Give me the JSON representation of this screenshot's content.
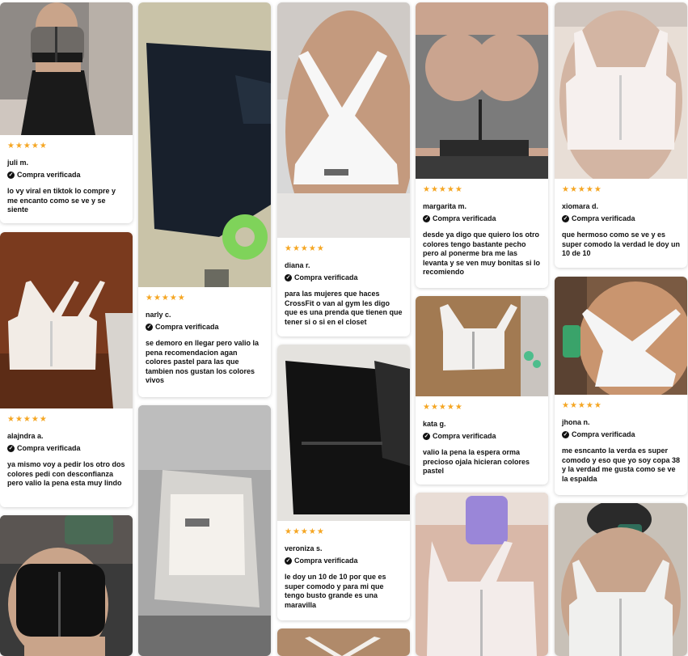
{
  "stars": "★★★★★",
  "verified_label": "Compra verificada",
  "verified_icon": "check-circle-icon",
  "columns": [
    {
      "reviews": [
        {
          "name": "juli m.",
          "text": "lo vy viral en tiktok lo compre y me encanto como se ve y se siente",
          "photo_colors": [
            "#6e6a66",
            "#1a1a1a",
            "#cfc6bf"
          ]
        },
        {
          "name": "alajndra a.",
          "text": "ya mismo voy a pedir los otro dos colores pedi con desconfianza pero valio la pena esta muy lindo",
          "photo_colors": [
            "#7a3a1e",
            "#f2ece6",
            "#5c2c16"
          ]
        },
        {
          "name": "",
          "text": "",
          "photo_colors": [
            "#3a3a3a",
            "#111111",
            "#c9a48a"
          ]
        }
      ]
    },
    {
      "reviews": [
        {
          "name": "narly c.",
          "text": "se demoro en llegar pero valio la pena recomendacion agan colores pastel para las que tambien nos gustan los colores vivos",
          "photo_colors": [
            "#c9c3a8",
            "#18202c",
            "#7fd35a"
          ]
        },
        {
          "name": "",
          "text": "",
          "photo_colors": [
            "#a8a8a8",
            "#f4f1ec",
            "#6e6e6e"
          ]
        }
      ]
    },
    {
      "reviews": [
        {
          "name": "diana r.",
          "text": "para las mujeres que haces CrossFit o van al gym les digo que es una prenda que tienen que tener si o si en el closet",
          "photo_colors": [
            "#d8d8d8",
            "#f7f7f7",
            "#c49a7e"
          ]
        },
        {
          "name": "veroniza s.",
          "text": "le doy un 10 de 10 por que es super comodo y para mi que tengo busto grande es una maravilla",
          "photo_colors": [
            "#e4e2de",
            "#121212",
            "#2b2b2b"
          ]
        },
        {
          "name": "",
          "text": "",
          "photo_colors": [
            "#b08a6a",
            "#f3f0ec",
            "#8a6a52"
          ]
        }
      ]
    },
    {
      "reviews": [
        {
          "name": "margarita m.",
          "text": "desde ya digo que quiero los otro colores tengo bastante pecho pero al ponerme bra me las levanta y se ven muy bonitas si lo recomiendo",
          "photo_colors": [
            "#caa48f",
            "#7b7b7b",
            "#2a2a2a"
          ]
        },
        {
          "name": "kata g.",
          "text": "valio la pena la espera orma precioso ojala hicieran colores pastel",
          "photo_colors": [
            "#a27a52",
            "#f2f0ee",
            "#4dbd8c"
          ]
        },
        {
          "name": "",
          "text": "",
          "photo_colors": [
            "#d9b8a8",
            "#f3ecea",
            "#9a86d8"
          ]
        }
      ]
    },
    {
      "reviews": [
        {
          "name": "xiomara d.",
          "text": "que hermoso como se ve y es super comodo la verdad le doy un 10 de 10",
          "photo_colors": [
            "#e8ded6",
            "#f6f0ee",
            "#d3b5a3"
          ]
        },
        {
          "name": "jhona n.",
          "text": "me esncanto la verda es super comodo y eso que yo soy copa 38 y la verdad me gusta como se ve la espalda",
          "photo_colors": [
            "#7a5a42",
            "#f5f5f5",
            "#3aa36a"
          ]
        },
        {
          "name": "",
          "text": "",
          "photo_colors": [
            "#c8c1b8",
            "#f0f0ee",
            "#2f6d5a"
          ]
        }
      ]
    }
  ]
}
